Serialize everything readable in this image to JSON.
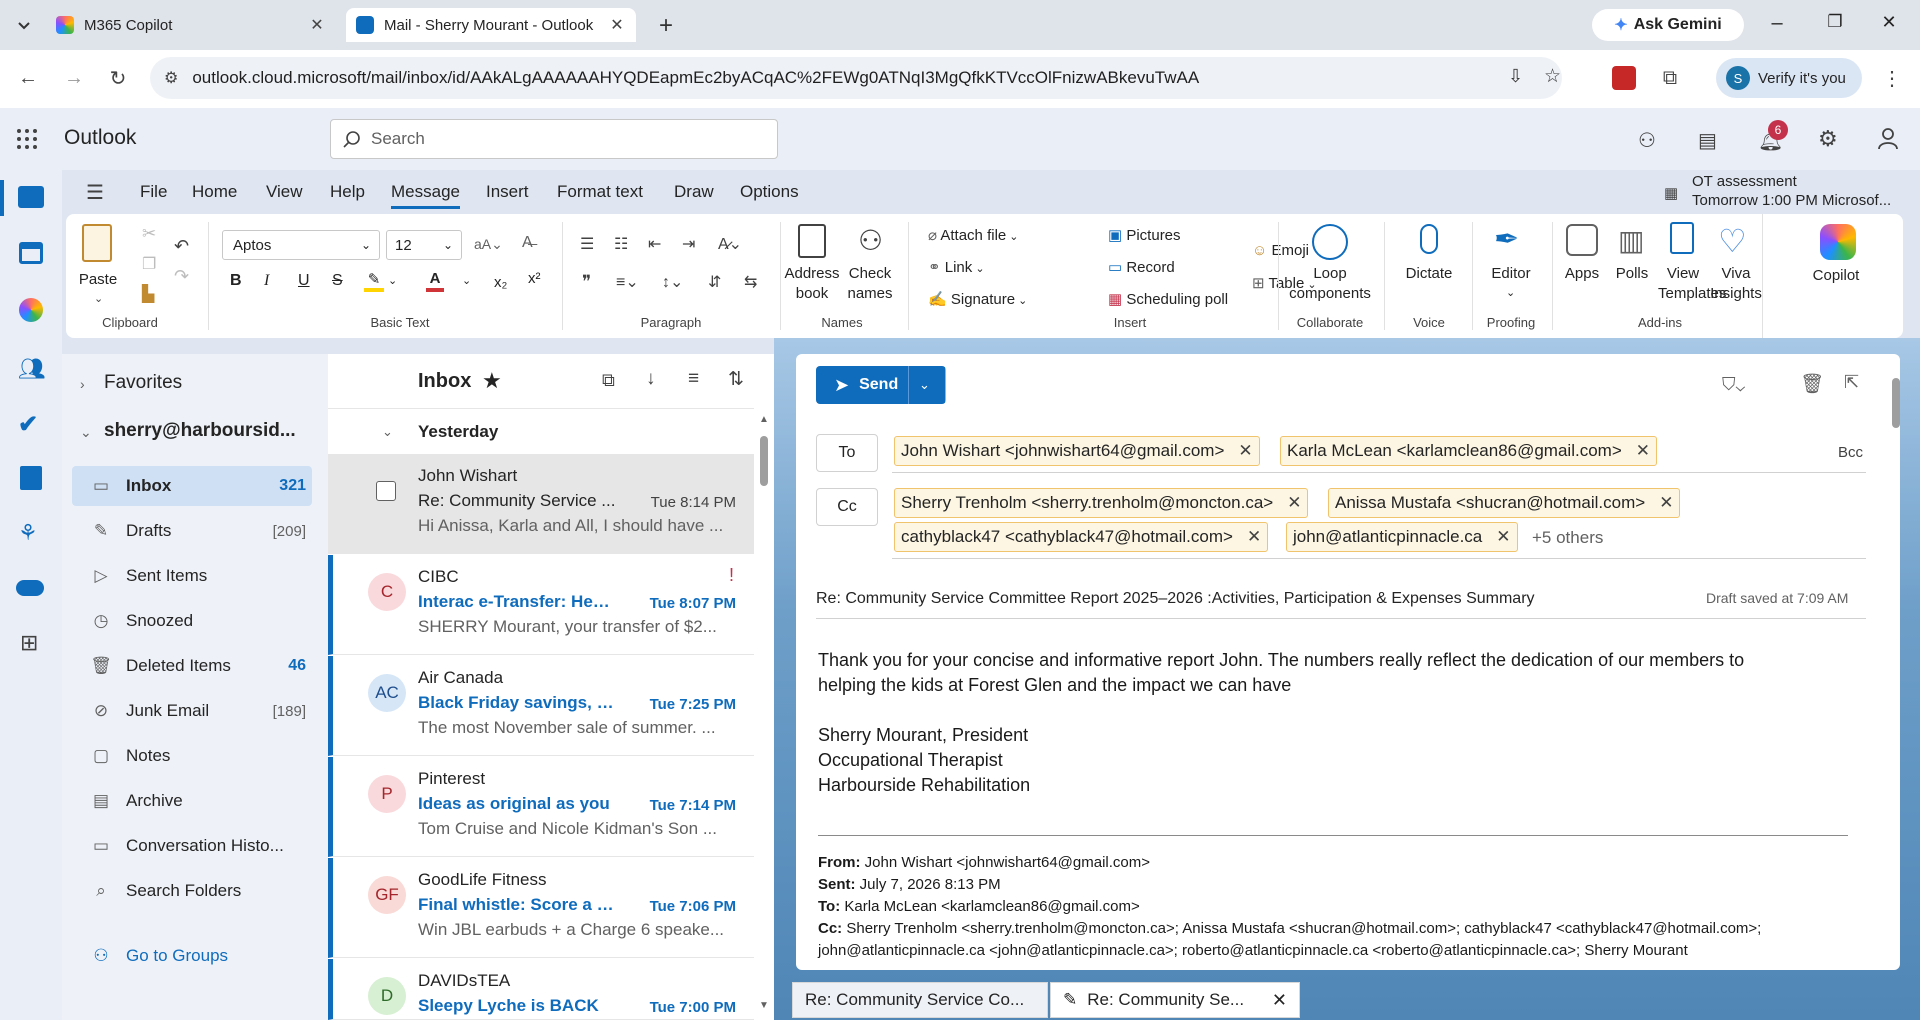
{
  "browser": {
    "tabs": [
      {
        "title": "M365 Copilot"
      },
      {
        "title": "Mail - Sherry Mourant - Outlook"
      }
    ],
    "ask_gemini": "Ask Gemini",
    "url": "outlook.cloud.microsoft/mail/inbox/id/AAkALgAAAAAAHYQDEapmEc2byACqAC%2FEWg0ATNqI3MgQfkKTVccOlFnizwABkevuTwAA",
    "verify": "Verify it's you",
    "profile_initial": "S"
  },
  "outlook": {
    "app_name": "Outlook",
    "search_placeholder": "Search",
    "notification_count": "6",
    "reminder": {
      "title": "OT assessment",
      "subtitle": "Tomorrow 1:00 PM Microsof..."
    }
  },
  "ribbon": {
    "tabs": [
      "File",
      "Home",
      "View",
      "Help",
      "Message",
      "Insert",
      "Format text",
      "Draw",
      "Options"
    ],
    "active_tab": "Message",
    "paste": "Paste",
    "clipboard": "Clipboard",
    "font_name": "Aptos",
    "font_size": "12",
    "basic_text": "Basic Text",
    "paragraph": "Paragraph",
    "address_book": "Address book",
    "check_names": "Check names",
    "names": "Names",
    "attach_file": "Attach file",
    "link": "Link",
    "signature": "Signature",
    "pictures": "Pictures",
    "record": "Record",
    "scheduling_poll": "Scheduling poll",
    "emoji": "Emoji",
    "table": "Table",
    "insert": "Insert",
    "loop": "Loop components",
    "collaborate": "Collaborate",
    "dictate": "Dictate",
    "voice": "Voice",
    "editor": "Editor",
    "proofing": "Proofing",
    "apps": "Apps",
    "polls": "Polls",
    "view_templates": "View Templates",
    "viva_insights": "Viva Insights",
    "add_ins": "Add-ins",
    "copilot": "Copilot"
  },
  "folders": {
    "favorites": "Favorites",
    "account": "sherry@harboursid...",
    "items": [
      {
        "label": "Inbox",
        "count": "321"
      },
      {
        "label": "Drafts",
        "count": "[209]"
      },
      {
        "label": "Sent Items",
        "count": ""
      },
      {
        "label": "Snoozed",
        "count": ""
      },
      {
        "label": "Deleted Items",
        "count": "46"
      },
      {
        "label": "Junk Email",
        "count": "[189]"
      },
      {
        "label": "Notes",
        "count": ""
      },
      {
        "label": "Archive",
        "count": ""
      },
      {
        "label": "Conversation Histo...",
        "count": ""
      },
      {
        "label": "Search Folders",
        "count": ""
      }
    ],
    "go_to_groups": "Go to Groups"
  },
  "message_list": {
    "title": "Inbox",
    "group": "Yesterday",
    "messages": [
      {
        "sender": "John Wishart",
        "subject": "Re: Community Service ...",
        "time": "Tue 8:14 PM",
        "preview": "Hi Anissa, Karla and All, I should have ...",
        "initials": "",
        "avatar_color": "#ffffff"
      },
      {
        "sender": "CIBC",
        "subject": "Interac e-Transfer: Heat...",
        "time": "Tue 8:07 PM",
        "preview": "SHERRY Mourant, your transfer of $2...",
        "initials": "C",
        "avatar_color": "#f9d9dc"
      },
      {
        "sender": "Air Canada",
        "subject": "Black Friday savings, bu...",
        "time": "Tue 7:25 PM",
        "preview": "The most November sale of summer. ...",
        "initials": "AC",
        "avatar_color": "#d6e6f7"
      },
      {
        "sender": "Pinterest",
        "subject": "Ideas as original as you",
        "time": "Tue 7:14 PM",
        "preview": "Tom Cruise and Nicole Kidman's Son ...",
        "initials": "P",
        "avatar_color": "#f9d9dc"
      },
      {
        "sender": "GoodLife Fitness",
        "subject": "Final whistle: Score a JB...",
        "time": "Tue 7:06 PM",
        "preview": "Win JBL earbuds + a Charge 6 speake...",
        "initials": "GF",
        "avatar_color": "#f9dad6"
      },
      {
        "sender": "DAVIDsTEA",
        "subject": "Sleepy Lyche is BACK",
        "time": "Tue 7:00 PM",
        "preview": "",
        "initials": "D",
        "avatar_color": "#d7efd2"
      }
    ]
  },
  "compose": {
    "send": "Send",
    "to_label": "To",
    "cc_label": "Cc",
    "bcc_label": "Bcc",
    "to": [
      "John Wishart <johnwishart64@gmail.com>",
      "Karla McLean <karlamclean86@gmail.com>"
    ],
    "cc": [
      "Sherry Trenholm <sherry.trenholm@moncton.ca>",
      "Anissa Mustafa <shucran@hotmail.com>",
      "cathyblack47 <cathyblack47@hotmail.com>",
      "john@atlanticpinnacle.ca"
    ],
    "cc_more": "+5 others",
    "subject": "Re: Community Service Committee Report 2025–2026 :Activities, Participation & Expenses Summary",
    "draft_saved": "Draft saved at 7:09 AM",
    "body": [
      "Thank you for your concise and informative report John. The numbers really reflect the dedication of our members to",
      "helping the kids at Forest Glen and the impact we can have",
      "",
      "Sherry Mourant, President",
      "Occupational Therapist",
      "Harbourside Rehabilitation"
    ],
    "quoted": {
      "from_label": "From:",
      "from": "John Wishart <johnwishart64@gmail.com>",
      "sent_label": "Sent:",
      "sent": "July 7, 2026 8:13 PM",
      "to_label": "To:",
      "to": "Karla McLean <karlamclean86@gmail.com>",
      "cc_label": "Cc:",
      "cc": "Sherry Trenholm <sherry.trenholm@moncton.ca>; Anissa Mustafa <shucran@hotmail.com>; cathyblack47 <cathyblack47@hotmail.com>;",
      "cc2": "john@atlanticpinnacle.ca <john@atlanticpinnacle.ca>; roberto@atlanticpinnacle.ca <roberto@atlanticpinnacle.ca>; Sherry Mourant"
    }
  },
  "bottom_tabs": [
    "Re: Community Service Co...",
    "Re: Community Se..."
  ],
  "colors": {
    "accent": "#0f6cbd",
    "chip_border": "#f0c36d",
    "unread_bar": "#0f6cbd"
  }
}
